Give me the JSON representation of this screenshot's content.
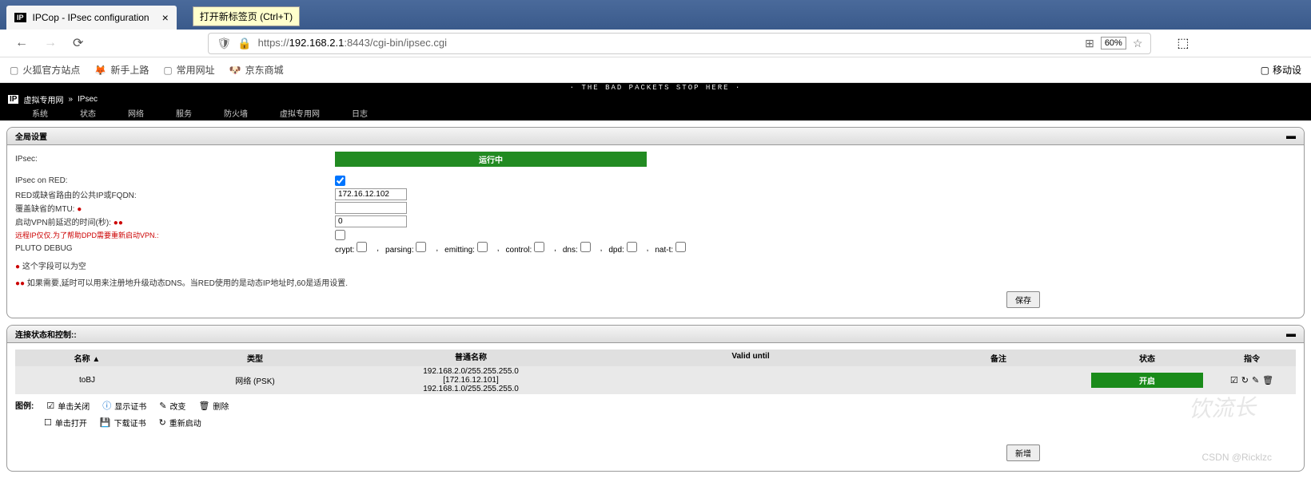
{
  "browser": {
    "tab_title": "IPCop - IPsec configuration",
    "new_tab_hint": "打开新标签页 (Ctrl+T)",
    "url_prefix": "https://",
    "url_host": "192.168.2.1",
    "url_path": ":8443/cgi-bin/ipsec.cgi",
    "zoom": "60%",
    "bookmarks": [
      {
        "icon": "folder",
        "label": "火狐官方站点"
      },
      {
        "icon": "globe",
        "label": "新手上路"
      },
      {
        "icon": "folder",
        "label": "常用网址"
      },
      {
        "icon": "jd",
        "label": "京东商城"
      }
    ],
    "mobile_label": "移动设"
  },
  "ipcop": {
    "banner": "· The bad Packets Stop Here ·",
    "logo": "IP",
    "breadcrumb": [
      "虚拟专用网",
      "»",
      "IPsec"
    ],
    "menu": [
      "系统",
      "状态",
      "网络",
      "服务",
      "防火墙",
      "虚拟专用网",
      "日志"
    ]
  },
  "global_settings": {
    "title": "全局设置",
    "rows": {
      "ipsec_label": "IPsec:",
      "status": "运行中",
      "ipsec_on_red_label": "IPsec on RED:",
      "red_ip_label": "RED或缺省路由的公共IP或FQDN:",
      "red_ip_value": "172.16.12.102",
      "mtu_label": "覆盖缺省的MTU:",
      "mtu_value": "",
      "vpn_delay_label": "启动VPN前延迟的时间(秒):",
      "vpn_delay_value": "0",
      "remote_ip_label": "远程IP仅仅.为了帮助DPD需要重新启动VPN.:",
      "pluto_label": "PLUTO DEBUG"
    },
    "pluto_opts": [
      "crypt:",
      "parsing:",
      "emitting:",
      "control:",
      "dns:",
      "dpd:",
      "nat-t:"
    ],
    "note1": "这个字段可以为空",
    "note2": "如果需要,延时可以用来注册地升级动态DNS。当RED使用的是动态IP地址时,60是适用设置.",
    "save_btn": "保存"
  },
  "conn_panel": {
    "title": "连接状态和控制::",
    "headers": {
      "name": "名称 ▲",
      "type": "类型",
      "cn": "普通名称",
      "valid": "Valid until",
      "remark": "备注",
      "status": "状态",
      "cmd": "指令"
    },
    "rows": [
      {
        "name": "toBJ",
        "type": "网络 (PSK)",
        "cn_lines": [
          "192.168.2.0/255.255.255.0",
          "[172.16.12.101]",
          "192.168.1.0/255.255.255.0"
        ],
        "valid": "",
        "remark": "",
        "status": "开启"
      }
    ],
    "legend_label": "图例:",
    "legend": [
      {
        "icon": "☑",
        "label": "单击关闭"
      },
      {
        "icon": "ⓘ",
        "label": "显示证书",
        "color": "#06c"
      },
      {
        "icon": "✎",
        "label": "改变"
      },
      {
        "icon": "🗑",
        "label": "删除"
      },
      {
        "icon": "☐",
        "label": "单击打开"
      },
      {
        "icon": "💾",
        "label": "下载证书"
      },
      {
        "icon": "↻",
        "label": "重新启动"
      }
    ],
    "add_btn": "新增"
  },
  "watermark": "饮流长",
  "csdn": "CSDN @Ricklzc"
}
